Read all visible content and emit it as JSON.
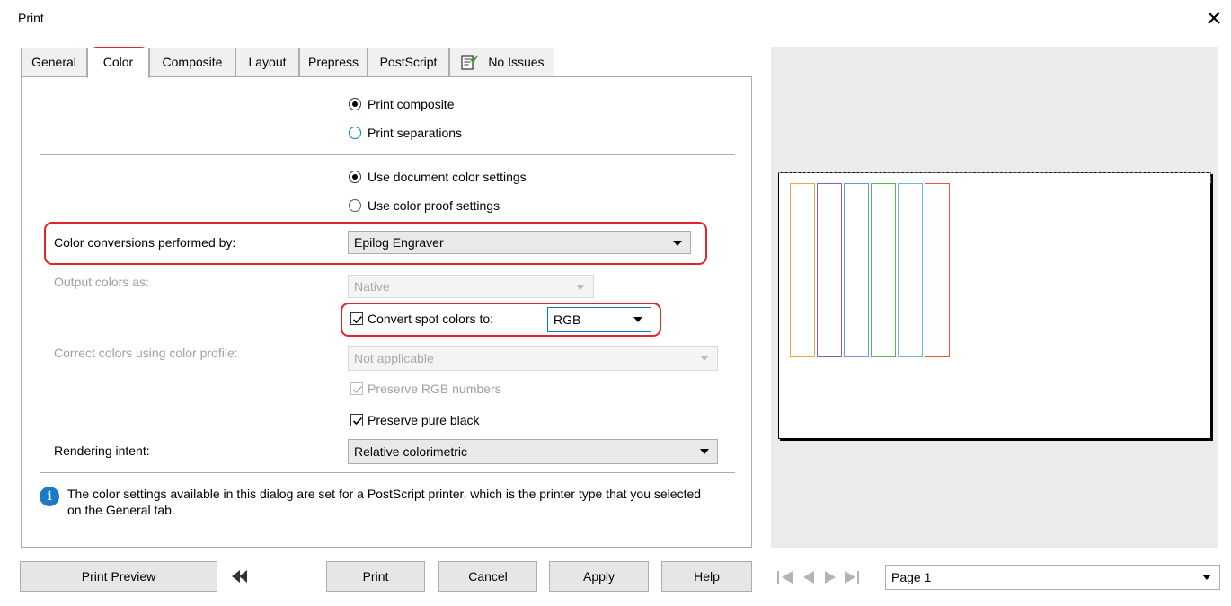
{
  "window": {
    "title": "Print",
    "close_icon": "close-icon"
  },
  "tabs": [
    {
      "label": "General"
    },
    {
      "label": "Color"
    },
    {
      "label": "Composite"
    },
    {
      "label": "Layout"
    },
    {
      "label": "Prepress"
    },
    {
      "label": "PostScript"
    },
    {
      "label": "No Issues",
      "icon": "document-check-icon"
    }
  ],
  "active_tab": "Color",
  "print_mode": {
    "composite_label": "Print composite",
    "separations_label": "Print separations",
    "selected": "composite"
  },
  "color_source": {
    "document_label": "Use document color settings",
    "proof_label": "Use color proof settings",
    "selected": "document"
  },
  "conversions": {
    "label": "Color conversions performed by:",
    "value": "Epilog Engraver"
  },
  "output_colors": {
    "label": "Output colors as:",
    "value": "Native",
    "enabled": false
  },
  "spot_colors": {
    "label": "Convert spot colors to:",
    "checked": true,
    "value": "RGB"
  },
  "color_profile": {
    "label": "Correct colors using color profile:",
    "value": "Not applicable",
    "enabled": false
  },
  "preserve_rgb": {
    "label": "Preserve RGB numbers",
    "checked": true,
    "enabled": false
  },
  "preserve_black": {
    "label": "Preserve pure black",
    "checked": true
  },
  "rendering_intent": {
    "label": "Rendering intent:",
    "value": "Relative colorimetric"
  },
  "info": {
    "text": "The color settings available in this dialog are set for a PostScript printer, which is the printer type that you selected on the General tab.",
    "icon": "info-icon"
  },
  "buttons": {
    "print_preview": "Print Preview",
    "collapse_icon": "collapse-arrow-icon",
    "print": "Print",
    "cancel": "Cancel",
    "apply": "Apply",
    "help": "Help"
  },
  "preview": {
    "page_selector": "Page 1",
    "strip_colors": [
      "#f0a640",
      "#8e5bbf",
      "#6f95d8",
      "#55b84a",
      "#69b8e8",
      "#e8563a"
    ]
  },
  "colors": {
    "highlight_red": "#e1232c",
    "info_blue": "#1c79c7"
  }
}
